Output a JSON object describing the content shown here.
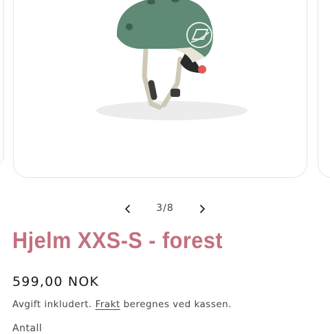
{
  "gallery": {
    "counter": "3/8",
    "image_alt": "Hjelm XXS-S - forest",
    "helmet_color": "#5e8a76",
    "strap_color": "#cfc8b8"
  },
  "product": {
    "title": "Hjelm XXS-S - forest",
    "price": "599,00 NOK",
    "tax_prefix": "Avgift inkludert.",
    "shipping_link": "Frakt",
    "tax_suffix": "beregnes ved kassen.",
    "quantity_label": "Antall"
  },
  "colors": {
    "title": "#c4707c",
    "text": "#444444"
  }
}
